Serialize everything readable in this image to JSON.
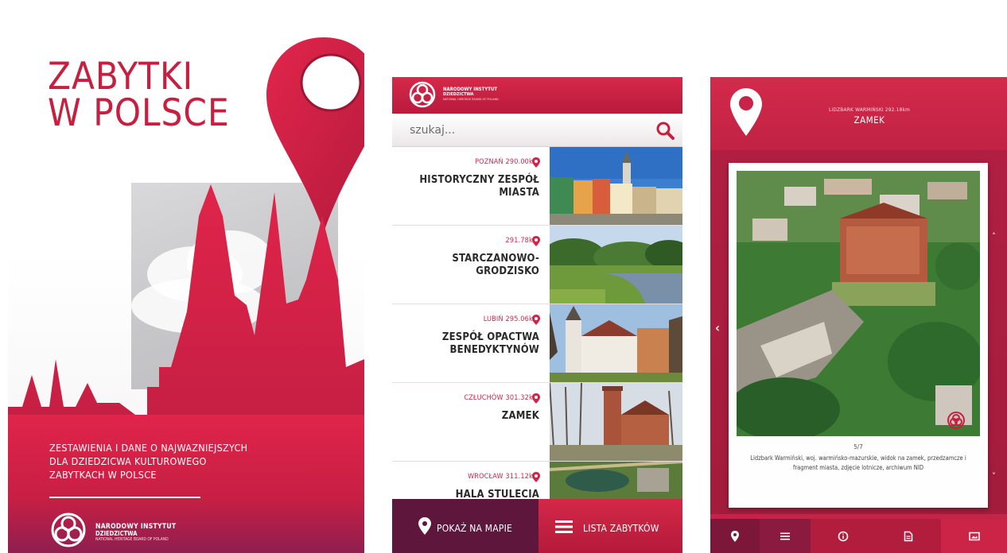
{
  "splash": {
    "title_line1": "ZABYTKI",
    "title_line2": "W POLSCE",
    "subtitle_line1": "ZESTAWIENIA I DANE O NAJWAZNIEJSZYCH",
    "subtitle_line2": "DLA DZIEDZICWA KULTUROWEGO",
    "subtitle_line3": "ZABYTKACH W POLSCE",
    "logo_line1": "NARODOWY INSTYTUT",
    "logo_line2": "DZIEDZICTWA",
    "logo_line3": "NATIONAL HERITAGE BOARD OF POLAND"
  },
  "list_screen": {
    "header": {
      "line1": "NARODOWY INSTYTUT",
      "line2": "DZIEDZICTWA",
      "line3": "NATIONAL HERITAGE BOARD OF POLAND"
    },
    "search": {
      "placeholder": "szukaj..."
    },
    "items": [
      {
        "location": "POZNAŃ 290.00km",
        "name": "HISTORYCZNY ZESPÓŁ MIASTA"
      },
      {
        "location": "291.78km",
        "name": "STARCZANOWO-GRODZISKO"
      },
      {
        "location": "LUBIŃ 295.06km",
        "name": "ZESPÓŁ OPACTWA BENEDYKTYNÓW"
      },
      {
        "location": "CZŁUCHÓW 301.32km",
        "name": "ZAMEK"
      },
      {
        "location": "WROCŁAW 311.12km",
        "name": "HALA STULECIA"
      }
    ],
    "bottom_bar": {
      "map_label": "POKAŻ NA MAPIE",
      "list_label": "LISTA ZABYTKÓW"
    }
  },
  "detail_screen": {
    "location": "LIDZBARK WARMIŃSKI 292.18km",
    "title": "ZAMEK",
    "counter": "5/7",
    "caption": "Lidzbark Warmiński, woj. warmińsko-mazurskie, widok na zamek, przedzamcze i fragment miasta, zdjęcie lotnicze, archiwum NID",
    "tabs": [
      "pin-icon",
      "list-icon",
      "info-icon",
      "document-icon",
      "image-icon"
    ]
  },
  "colors": {
    "brand_red": "#c61f3f",
    "brand_dark": "#5e163d",
    "detail_bg": "#a31c3c"
  }
}
